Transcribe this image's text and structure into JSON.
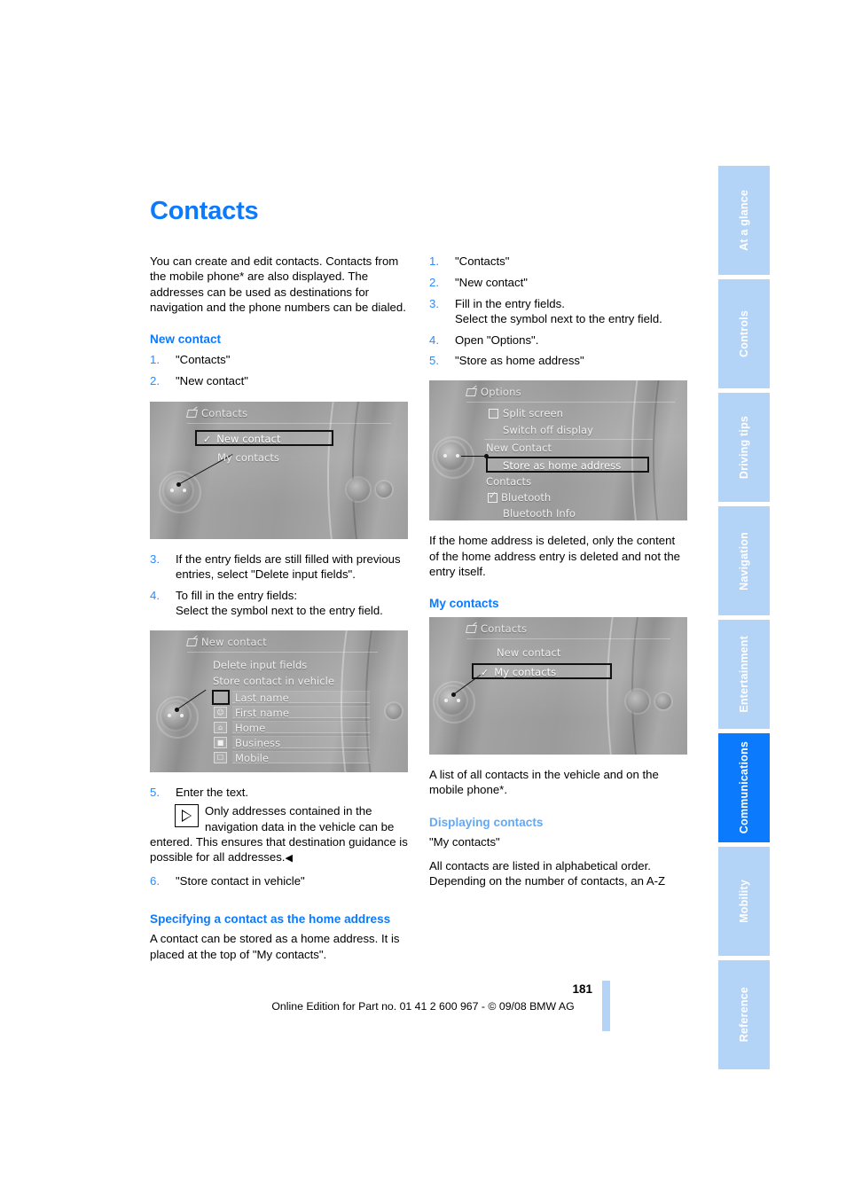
{
  "document": {
    "title": "Contacts",
    "page_number": "181",
    "footer": "Online Edition for Part no. 01 41 2 600 967  - © 09/08 BMW AG"
  },
  "side_tabs": [
    {
      "label": "At a glance",
      "active": false
    },
    {
      "label": "Controls",
      "active": false
    },
    {
      "label": "Driving tips",
      "active": false
    },
    {
      "label": "Navigation",
      "active": false
    },
    {
      "label": "Entertainment",
      "active": false
    },
    {
      "label": "Communications",
      "active": true
    },
    {
      "label": "Mobility",
      "active": false
    },
    {
      "label": "Reference",
      "active": false
    }
  ],
  "left_column": {
    "intro": "You can create and edit contacts. Contacts from the mobile phone* are also displayed. The addresses can be used as destinations for navigation and the phone numbers can be dialed.",
    "section_new_contact": "New contact",
    "steps_a": [
      {
        "num": "1.",
        "text": "\"Contacts\""
      },
      {
        "num": "2.",
        "text": "\"New contact\""
      }
    ],
    "steps_b": [
      {
        "num": "3.",
        "text": "If the entry fields are still filled with previous entries, select \"Delete input fields\"."
      },
      {
        "num": "4.",
        "text": "To fill in the entry fields:",
        "sub": "Select the symbol next to the entry field."
      }
    ],
    "step_5_num": "5.",
    "step_5_text": "Enter the text.",
    "note_text": "Only addresses contained in the navigation data in the vehicle can be",
    "note_text_cont": "entered. This ensures that destination guidance is possible for all addresses.",
    "note_endmark": "◀",
    "step_6_num": "6.",
    "step_6_text": "\"Store contact in vehicle\"",
    "section_home_address": "Specifying a contact as the home address",
    "home_address_para": "A contact can be stored as a home address. It is placed at the top of \"My contacts\"."
  },
  "right_column": {
    "steps": [
      {
        "num": "1.",
        "text": "\"Contacts\""
      },
      {
        "num": "2.",
        "text": "\"New contact\""
      },
      {
        "num": "3.",
        "text": "Fill in the entry fields.",
        "sub": "Select the symbol next to the entry field."
      },
      {
        "num": "4.",
        "text": "Open \"Options\"."
      },
      {
        "num": "5.",
        "text": "\"Store as home address\""
      }
    ],
    "after_options_para": "If the home address is deleted, only the content of the home address entry is deleted and not the entry itself.",
    "section_my_contacts": "My contacts",
    "my_contacts_para": "A list of all contacts in the vehicle and on the mobile phone*.",
    "section_displaying_contacts": "Displaying contacts",
    "displaying_quote": "\"My contacts\"",
    "displaying_para": "All contacts are listed in alphabetical order. Depending on the number of contacts, an A-Z"
  },
  "idrive_screens": {
    "contacts_new": {
      "header": "Contacts",
      "items": [
        {
          "label": "New contact",
          "selected": true,
          "checked": true
        },
        {
          "label": "My contacts",
          "selected": false,
          "checked": false
        }
      ]
    },
    "new_contact_form": {
      "header": "New contact",
      "actions": [
        {
          "label": "Delete input fields"
        },
        {
          "label": "Store contact in vehicle"
        }
      ],
      "fields": [
        {
          "label": "Last name",
          "selected": true
        },
        {
          "label": "First name",
          "selected": false
        },
        {
          "label": "Home",
          "selected": false
        },
        {
          "label": "Business",
          "selected": false
        },
        {
          "label": "Mobile",
          "selected": false
        }
      ]
    },
    "options_menu": {
      "header": "Options",
      "items": [
        {
          "label": "Split screen",
          "checkbox": true,
          "ticked": false,
          "selected": false
        },
        {
          "label": "Switch off display",
          "checkbox": false,
          "selected": false
        },
        {
          "label": "New Contact",
          "checkbox": false,
          "selected": false
        },
        {
          "label": "Store as home address",
          "checkbox": false,
          "selected": true
        },
        {
          "label": "Contacts",
          "checkbox": false,
          "selected": false
        },
        {
          "label": "Bluetooth",
          "checkbox": true,
          "ticked": true,
          "selected": false
        },
        {
          "label": "Bluetooth Info",
          "checkbox": false,
          "selected": false
        }
      ]
    },
    "contacts_my": {
      "header": "Contacts",
      "items": [
        {
          "label": "New contact",
          "selected": false,
          "checked": false
        },
        {
          "label": "My contacts",
          "selected": true,
          "checked": true
        }
      ]
    }
  },
  "colors": {
    "accent_blue": "#0c7afc",
    "soft_blue": "#62a9f6",
    "tab_blue": "#b3d3f7"
  }
}
